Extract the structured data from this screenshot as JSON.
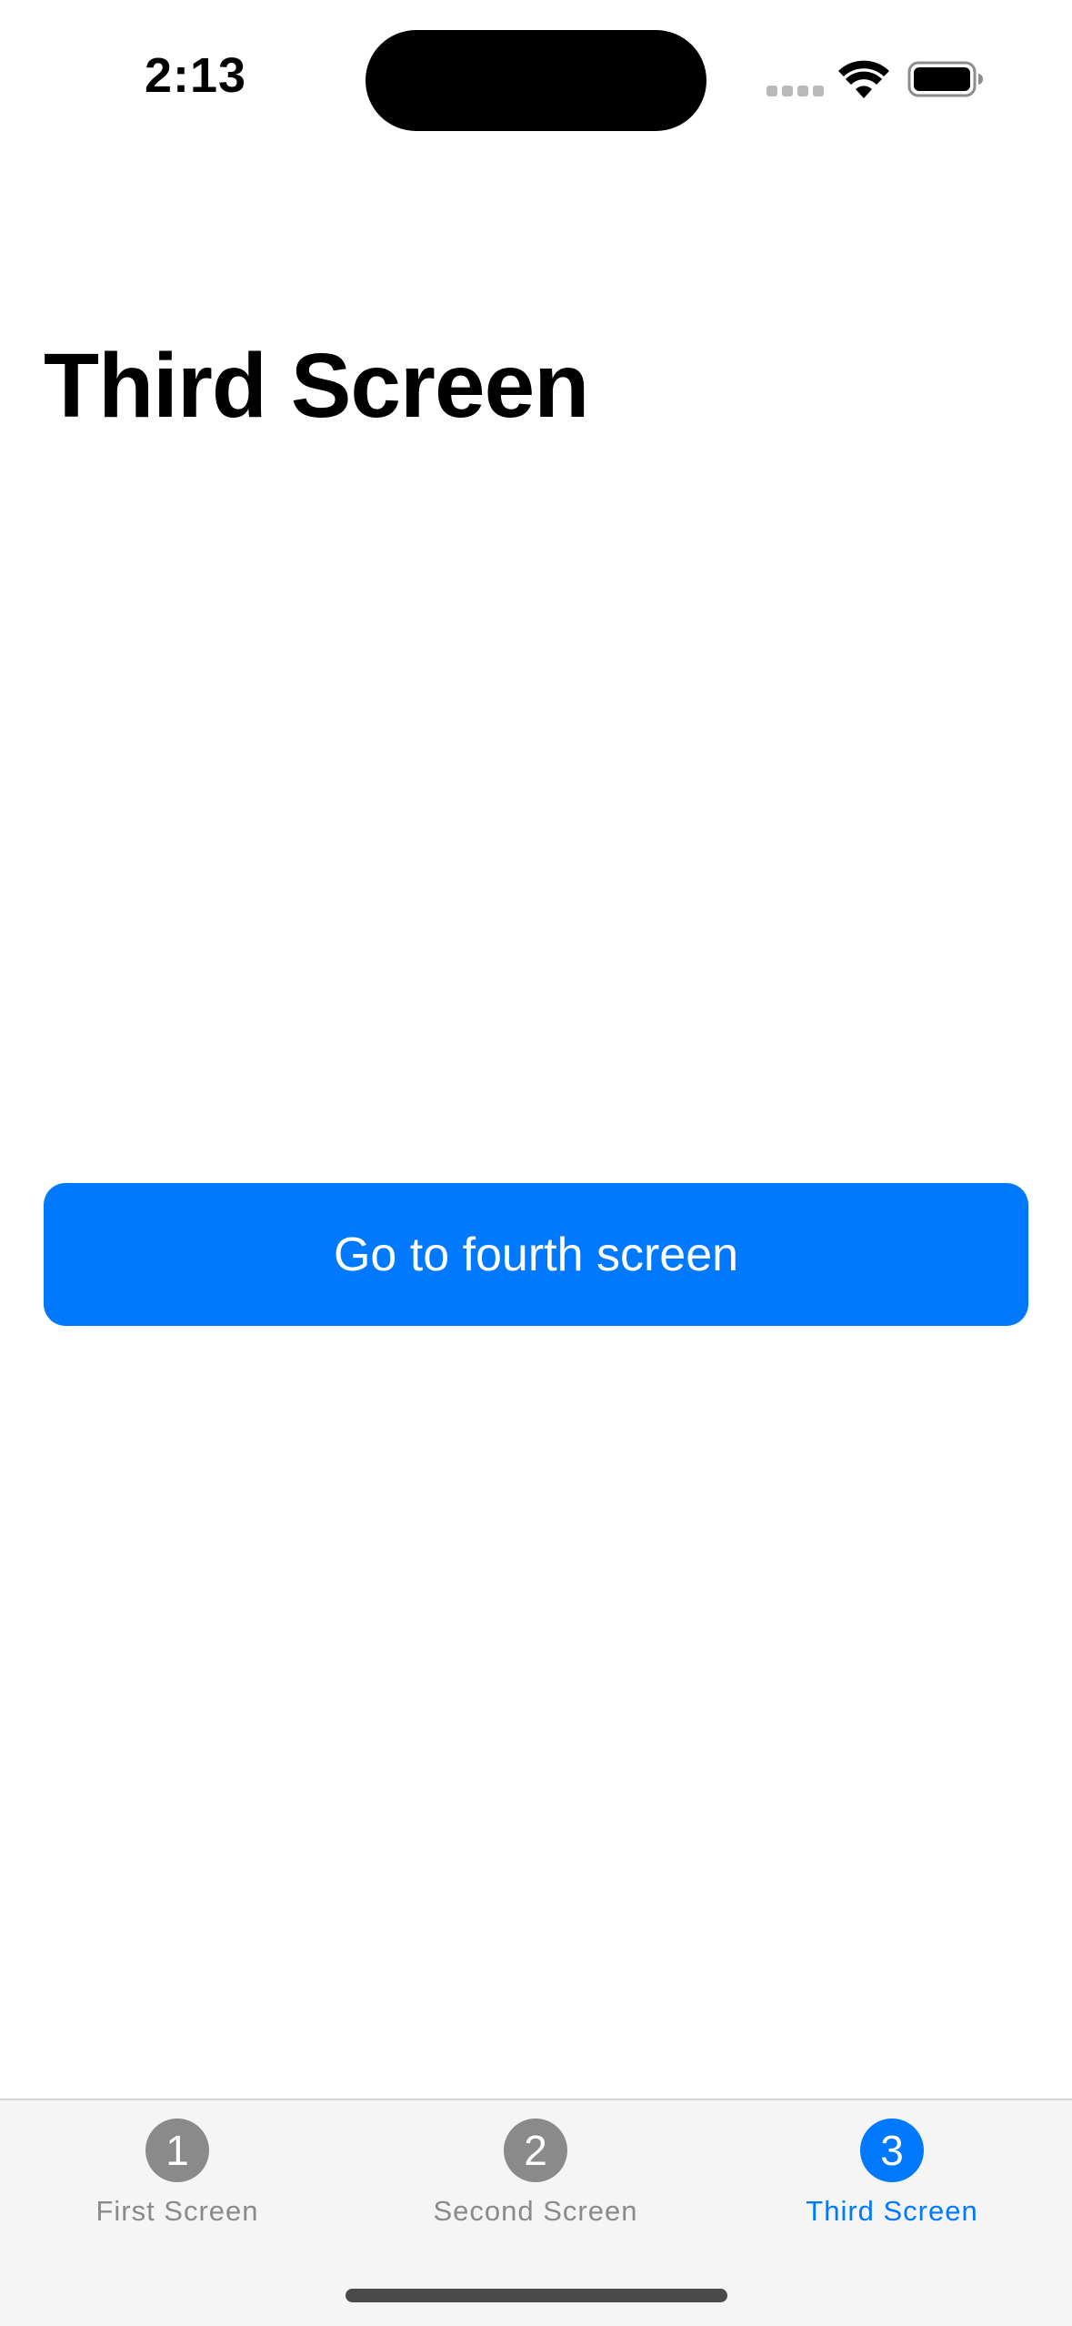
{
  "status_bar": {
    "time": "2:13",
    "icons": [
      "signal-icon",
      "wifi-icon",
      "battery-icon"
    ]
  },
  "page": {
    "title": "Third Screen"
  },
  "main": {
    "button_label": "Go to fourth screen"
  },
  "tab_bar": {
    "tabs": [
      {
        "number": "1",
        "label": "First Screen",
        "selected": false
      },
      {
        "number": "2",
        "label": "Second Screen",
        "selected": false
      },
      {
        "number": "3",
        "label": "Third Screen",
        "selected": true
      }
    ]
  },
  "colors": {
    "accent": "#0079FE",
    "inactive_tab": "#8A8A8A",
    "tab_bar_background": "#F5F5F5"
  }
}
